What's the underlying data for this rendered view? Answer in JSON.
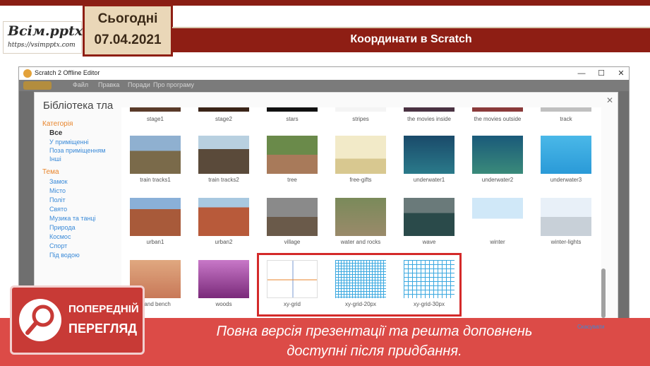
{
  "slide": {
    "logo_text": "Всім.pptx",
    "logo_url": "https://vsimpptx.com",
    "date_day": "Сьогодні",
    "date_value": "07.04.2021",
    "title": "Координати в Scratch"
  },
  "window": {
    "title": "Scratch 2 Offline Editor",
    "controls": [
      "—",
      "☐",
      "✕"
    ],
    "menu": [
      "Файл",
      "Правка",
      "Поради",
      "Про програму"
    ]
  },
  "library": {
    "title": "Бібліотека тла",
    "category_heading": "Категорія",
    "categories": [
      "Все",
      "У приміщенні",
      "Поза приміщенням",
      "Інші"
    ],
    "theme_heading": "Тема",
    "themes": [
      "Замок",
      "Місто",
      "Політ",
      "Свято",
      "Музика та танці",
      "Природа",
      "Космос",
      "Спорт",
      "Під водою"
    ],
    "top_row": [
      "stage1",
      "stage2",
      "stars",
      "stripes",
      "the movies inside",
      "the movies outside",
      "track"
    ],
    "row1": [
      "train tracks1",
      "train tracks2",
      "tree",
      "free-gifts",
      "underwater1",
      "underwater2",
      "underwater3"
    ],
    "row2": [
      "urban1",
      "urban2",
      "village",
      "water and rocks",
      "wave",
      "winter",
      "winter-lights"
    ],
    "row3": [
      "s and bench",
      "woods",
      "xy-grid",
      "xy-grid-20px",
      "xy-grid-30px"
    ],
    "cancel_label": "Скасувати"
  },
  "banner": {
    "preview_line1": "ПОПЕРЕДНІЙ",
    "preview_line2": "ПЕРЕГЛЯД",
    "line1": "Повна версія презентації та решта доповнень",
    "line2": "доступні після придбання."
  },
  "colors": {
    "accent": "#8e1e14",
    "banner": "#dc4b47",
    "highlight": "#d42a2a",
    "link": "#3a8ad8",
    "heading": "#e8852c"
  }
}
